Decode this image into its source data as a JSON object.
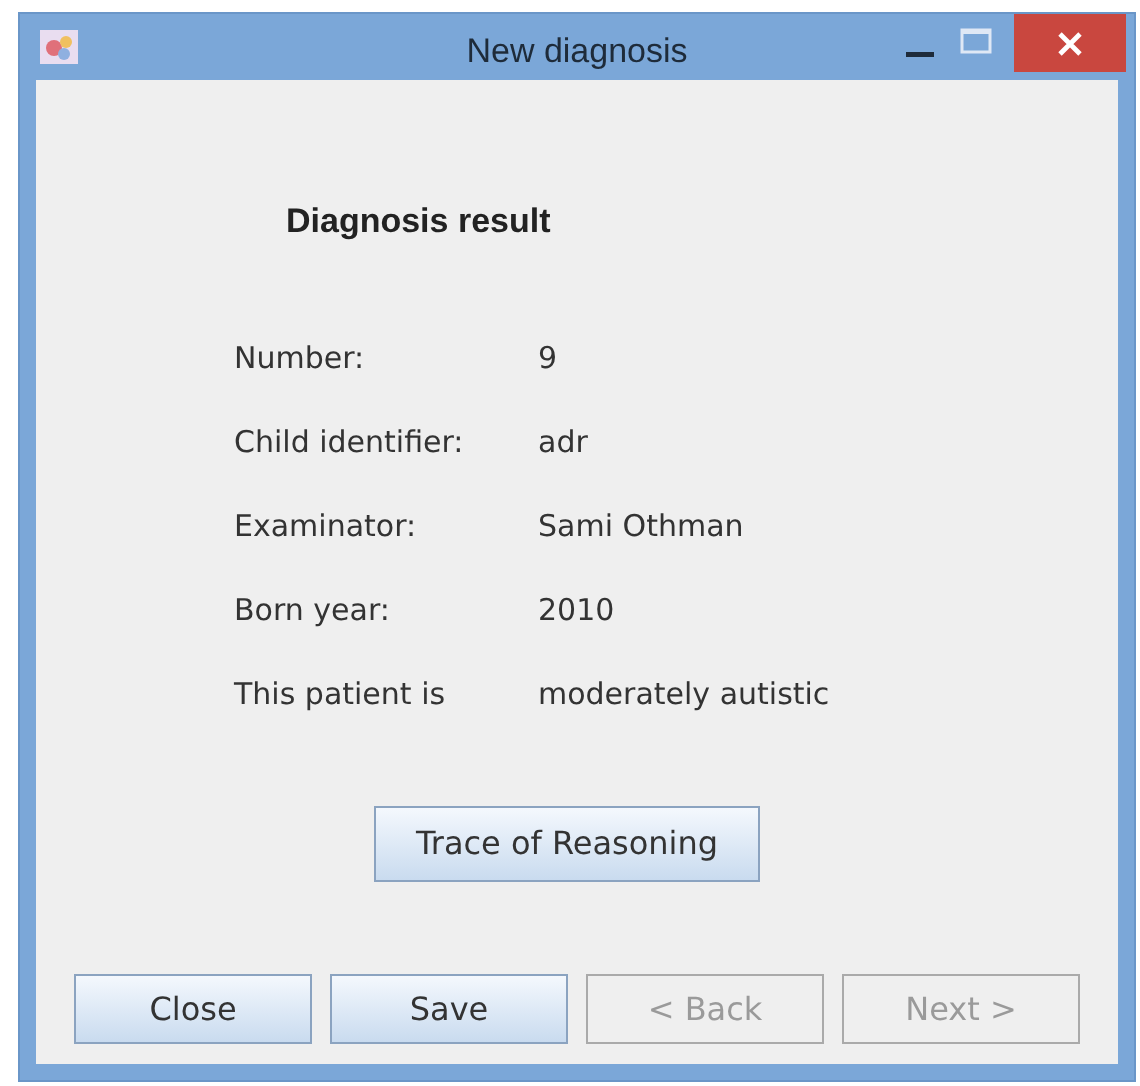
{
  "window": {
    "title": "New diagnosis"
  },
  "heading": "Diagnosis result",
  "fields": [
    {
      "label": "Number:",
      "value": "9"
    },
    {
      "label": "Child identifier:",
      "value": "adr"
    },
    {
      "label": "Examinator:",
      "value": "Sami Othman"
    },
    {
      "label": "Born year:",
      "value": "2010"
    },
    {
      "label": "This patient is",
      "value": "moderately autistic"
    }
  ],
  "trace_button": "Trace of Reasoning",
  "buttons": [
    {
      "label": "Close",
      "disabled": false
    },
    {
      "label": "Save",
      "disabled": false
    },
    {
      "label": "< Back",
      "disabled": true
    },
    {
      "label": "Next >",
      "disabled": true
    }
  ]
}
